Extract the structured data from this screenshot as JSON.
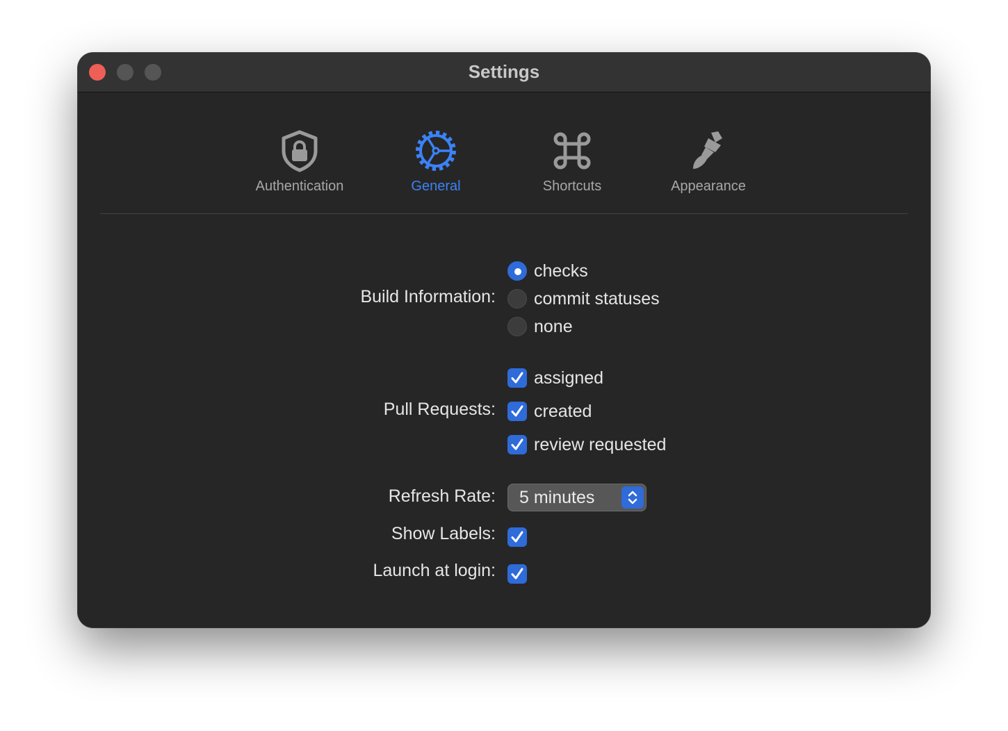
{
  "window": {
    "title": "Settings"
  },
  "tabs": [
    {
      "label": "Authentication",
      "icon": "lock-shield-icon",
      "active": false
    },
    {
      "label": "General",
      "icon": "gear-icon",
      "active": true
    },
    {
      "label": "Shortcuts",
      "icon": "command-icon",
      "active": false
    },
    {
      "label": "Appearance",
      "icon": "paintbrush-icon",
      "active": false
    }
  ],
  "general": {
    "build_information": {
      "label": "Build Information:",
      "options": [
        "checks",
        "commit statuses",
        "none"
      ],
      "selected": "checks"
    },
    "pull_requests": {
      "label": "Pull Requests:",
      "options": [
        {
          "label": "assigned",
          "checked": true
        },
        {
          "label": "created",
          "checked": true
        },
        {
          "label": "review requested",
          "checked": true
        }
      ]
    },
    "refresh_rate": {
      "label": "Refresh Rate:",
      "value": "5 minutes"
    },
    "show_labels": {
      "label": "Show Labels:",
      "checked": true
    },
    "launch_at_login": {
      "label": "Launch at login:",
      "checked": true
    }
  },
  "colors": {
    "accent": "#3b82f6",
    "control_blue": "#2f6bd9",
    "window_bg": "#262626",
    "titlebar_bg": "#333333",
    "close_button": "#ee5f57"
  }
}
